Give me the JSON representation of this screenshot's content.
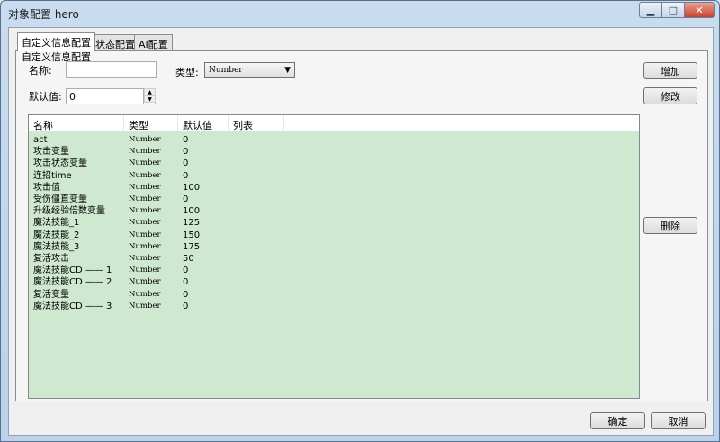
{
  "window": {
    "title": "对象配置 hero"
  },
  "tabs": [
    {
      "label": "自定义信息配置",
      "active": true
    },
    {
      "label": "状态配置",
      "active": false
    },
    {
      "label": "AI配置",
      "active": false
    }
  ],
  "group_label": "自定义信息配置",
  "form": {
    "name_label": "名称:",
    "name_value": "",
    "type_label": "类型:",
    "type_value": "Number",
    "default_label": "默认值:",
    "default_value": "0"
  },
  "buttons": {
    "add": "增加",
    "modify": "修改",
    "delete": "删除",
    "ok": "确定",
    "cancel": "取消"
  },
  "table": {
    "columns": [
      "名称",
      "类型",
      "默认值",
      "列表"
    ],
    "rows": [
      [
        "act",
        "Number",
        "0",
        ""
      ],
      [
        "攻击变量",
        "Number",
        "0",
        ""
      ],
      [
        "攻击状态变量",
        "Number",
        "0",
        ""
      ],
      [
        "连招time",
        "Number",
        "0",
        ""
      ],
      [
        "攻击值",
        "Number",
        "100",
        ""
      ],
      [
        "受伤僵直变量",
        "Number",
        "0",
        ""
      ],
      [
        "升级经验倍数变量",
        "Number",
        "100",
        ""
      ],
      [
        "魔法技能_1",
        "Number",
        "125",
        ""
      ],
      [
        "魔法技能_2",
        "Number",
        "150",
        ""
      ],
      [
        "魔法技能_3",
        "Number",
        "175",
        ""
      ],
      [
        "复活攻击",
        "Number",
        "50",
        ""
      ],
      [
        "魔法技能CD —— 1",
        "Number",
        "0",
        ""
      ],
      [
        "魔法技能CD —— 2",
        "Number",
        "0",
        ""
      ],
      [
        "复活变量",
        "Number",
        "0",
        ""
      ],
      [
        "魔法技能CD —— 3",
        "Number",
        "0",
        ""
      ]
    ]
  },
  "colors": {
    "list_background": "#cfe8d0",
    "titlebar": "#c9dcef",
    "close_button": "#c7432c"
  }
}
